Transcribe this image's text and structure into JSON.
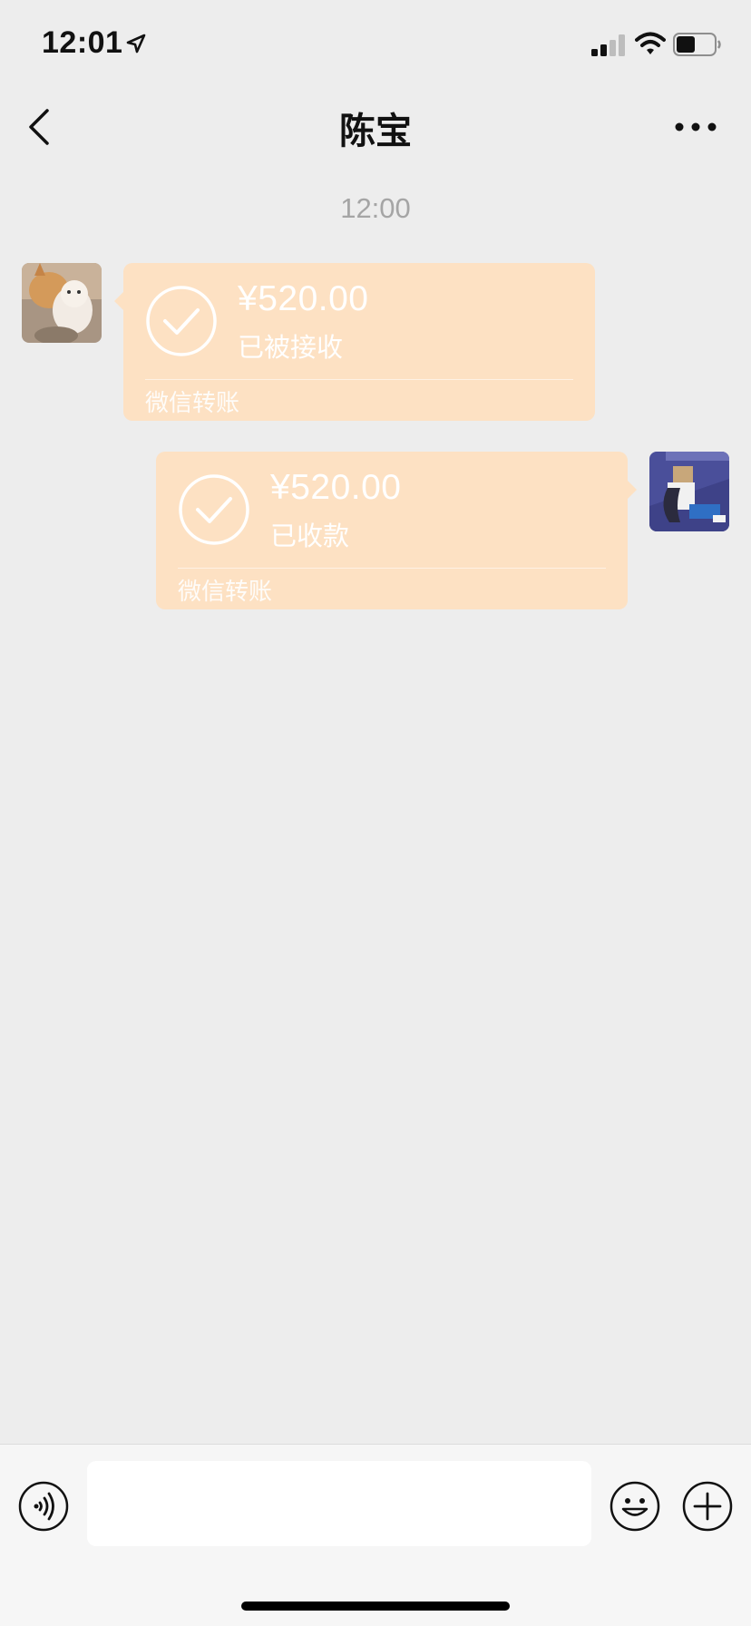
{
  "status_bar": {
    "time": "12:01",
    "signal_bars_active": 2,
    "battery_level": 0.5
  },
  "nav": {
    "title": "陈宝",
    "back_icon": "chevron-left-icon",
    "more_icon": "ellipsis-icon"
  },
  "chat": {
    "timestamp": "12:00",
    "messages": [
      {
        "side": "left",
        "avatar": "dog-avatar",
        "amount": "¥520.00",
        "status": "已被接收",
        "footer": "微信转账"
      },
      {
        "side": "right",
        "avatar": "girl-avatar",
        "amount": "¥520.00",
        "status": "已收款",
        "footer": "微信转账"
      }
    ]
  },
  "input_bar": {
    "message_value": "",
    "voice_icon": "voice-icon",
    "emoji_icon": "emoji-icon",
    "plus_icon": "plus-icon"
  },
  "colors": {
    "background": "#ededed",
    "bubble": "#fde1c3",
    "input_bar": "#f6f6f6",
    "timestamp": "#a5a5a5"
  }
}
